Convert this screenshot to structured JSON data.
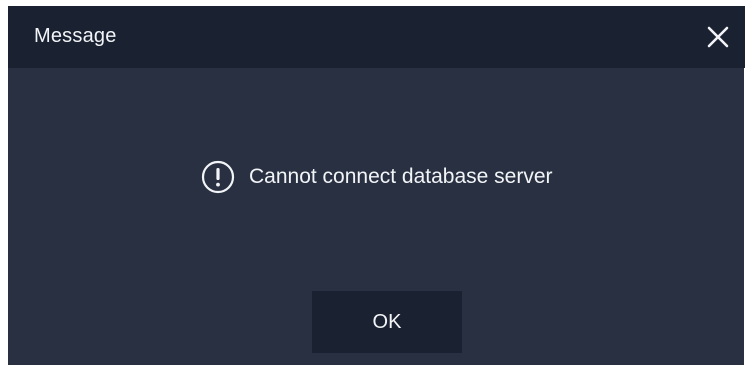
{
  "window": {
    "title": "Message",
    "close_icon": "close-icon"
  },
  "message": {
    "icon": "exclamation-circle-icon",
    "text": "Cannot connect database server"
  },
  "actions": {
    "ok_label": "OK"
  },
  "colors": {
    "titlebar_bg": "#1a2130",
    "body_bg": "#283042",
    "text": "#f2f4f7"
  }
}
